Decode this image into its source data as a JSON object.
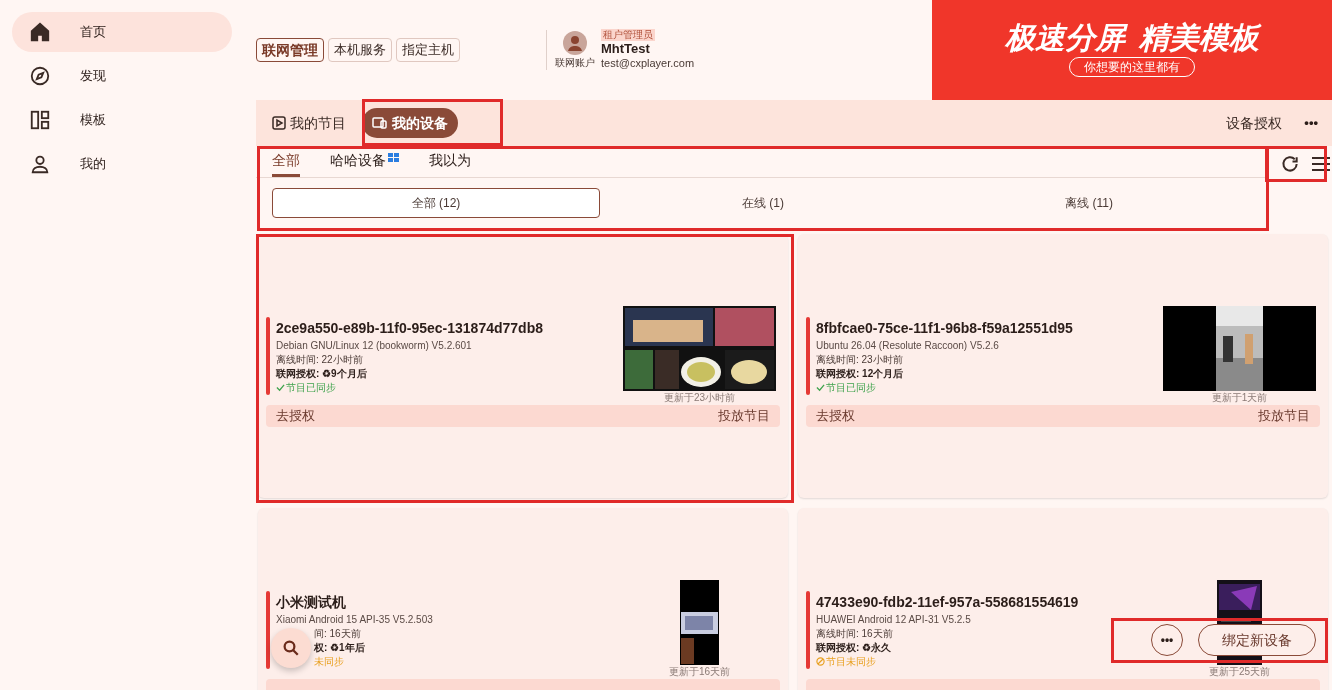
{
  "sidebar": {
    "items": [
      {
        "kind": "home",
        "label": "首页",
        "selected": true
      },
      {
        "kind": "compass",
        "label": "发现",
        "selected": false
      },
      {
        "kind": "layout",
        "label": "模板",
        "selected": false
      },
      {
        "kind": "person",
        "label": "我的",
        "selected": false
      }
    ]
  },
  "header": {
    "modes": [
      {
        "label": "联网管理",
        "selected": true
      },
      {
        "label": "本机服务",
        "selected": false
      },
      {
        "label": "指定主机",
        "selected": false
      }
    ],
    "account": {
      "caption": "联网账户",
      "role": "租户管理员",
      "name": "MhtTest",
      "email": "test@cxplayer.com"
    },
    "banner": {
      "title_1": "极速分屏",
      "title_2": "精美模板",
      "subtitle": "你想要的这里都有"
    }
  },
  "main_tabs": [
    {
      "kind": "program",
      "label": "我的节目",
      "selected": false
    },
    {
      "kind": "device",
      "label": "我的设备",
      "selected": true
    }
  ],
  "toolbar": {
    "authorize": "设备授权",
    "more": "•••"
  },
  "groups": [
    {
      "label": "全部",
      "selected": true,
      "badge": false
    },
    {
      "label": "哈哈设备",
      "selected": false,
      "badge": true
    },
    {
      "label": "我以为",
      "selected": false,
      "badge": false
    }
  ],
  "filters": [
    {
      "label": "全部 (12)",
      "selected": true
    },
    {
      "label": "在线 (1)",
      "selected": false
    },
    {
      "label": "离线 (11)",
      "selected": false
    }
  ],
  "devices": [
    {
      "name": "2ce9a550-e89b-11f0-95ec-131874d77db8",
      "system": "Debian GNU/Linux 12 (bookworm) V5.2.601",
      "offline": "离线时间: 22小时前",
      "license": "联网授权: ♻9个月后",
      "sync": "节目已同步",
      "synced": true,
      "updated": "更新于23小时前",
      "covered": false,
      "deauthorize": "去授权",
      "play": "投放节目"
    },
    {
      "name": "8fbfcae0-75ce-11f1-96b8-f59a12551d95",
      "system": "Ubuntu 26.04 (Resolute Raccoon) V5.2.6",
      "offline": "离线时间: 23小时前",
      "license": "联网授权: 12个月后",
      "sync": "节目已同步",
      "synced": true,
      "updated": "更新于1天前",
      "covered": false,
      "deauthorize": "去授权",
      "play": "投放节目"
    },
    {
      "name": "小米测试机",
      "system": "Xiaomi Android 15 API-35 V5.2.503",
      "offline": "间: 16天前",
      "license": "权: ♻1年后",
      "sync": "未同步",
      "synced": false,
      "updated": "更新于16天前",
      "covered": true
    },
    {
      "name": "47433e90-fdb2-11ef-957a-558681554619",
      "system": "HUAWEI Android 12 API-31 V5.2.5",
      "offline": "离线时间: 16天前",
      "license": "联网授权: ♻永久",
      "sync": "节目未同步",
      "synced": false,
      "updated": "更新于25天前",
      "covered": false
    }
  ],
  "fab": {
    "more": "•••",
    "bind": "绑定新设备"
  }
}
